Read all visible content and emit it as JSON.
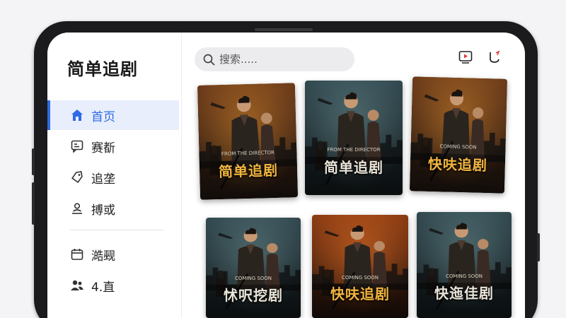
{
  "app": {
    "title": "简单追剧"
  },
  "search": {
    "placeholder": "搜索....."
  },
  "sidebar": {
    "items": [
      {
        "label": "首页",
        "icon": "home-icon",
        "active": true
      },
      {
        "label": "赛斱",
        "icon": "message-icon",
        "active": false
      },
      {
        "label": "追垄",
        "icon": "tag-icon",
        "active": false
      },
      {
        "label": "搏或",
        "icon": "person-icon",
        "active": false
      },
      {
        "label": "澔觋",
        "icon": "calendar-icon",
        "active": false
      },
      {
        "label": "4.直",
        "icon": "users-icon",
        "active": false
      }
    ]
  },
  "header": {
    "icons": [
      "play-icon",
      "notification-icon"
    ]
  },
  "posters": [
    {
      "title": "简单追剧",
      "tagline": "FROM THE DIRECTOR",
      "theme": "amber"
    },
    {
      "title": "简单追剧",
      "tagline": "FROM THE DIRECTOR",
      "theme": "teal"
    },
    {
      "title": "快呋追剧",
      "tagline": "COMING SOON",
      "theme": "amber"
    },
    {
      "title": "怵呎挖剧",
      "tagline": "COMING SOON",
      "theme": "teal"
    },
    {
      "title": "快呋追剧",
      "tagline": "COMING SOON",
      "theme": "orange"
    },
    {
      "title": "快迤佳剧",
      "tagline": "COMING SOON",
      "theme": "teal"
    }
  ],
  "colors": {
    "accent": "#2f6ae6",
    "amber_title": "#f2b640",
    "teal_title": "#e9e4d8"
  }
}
